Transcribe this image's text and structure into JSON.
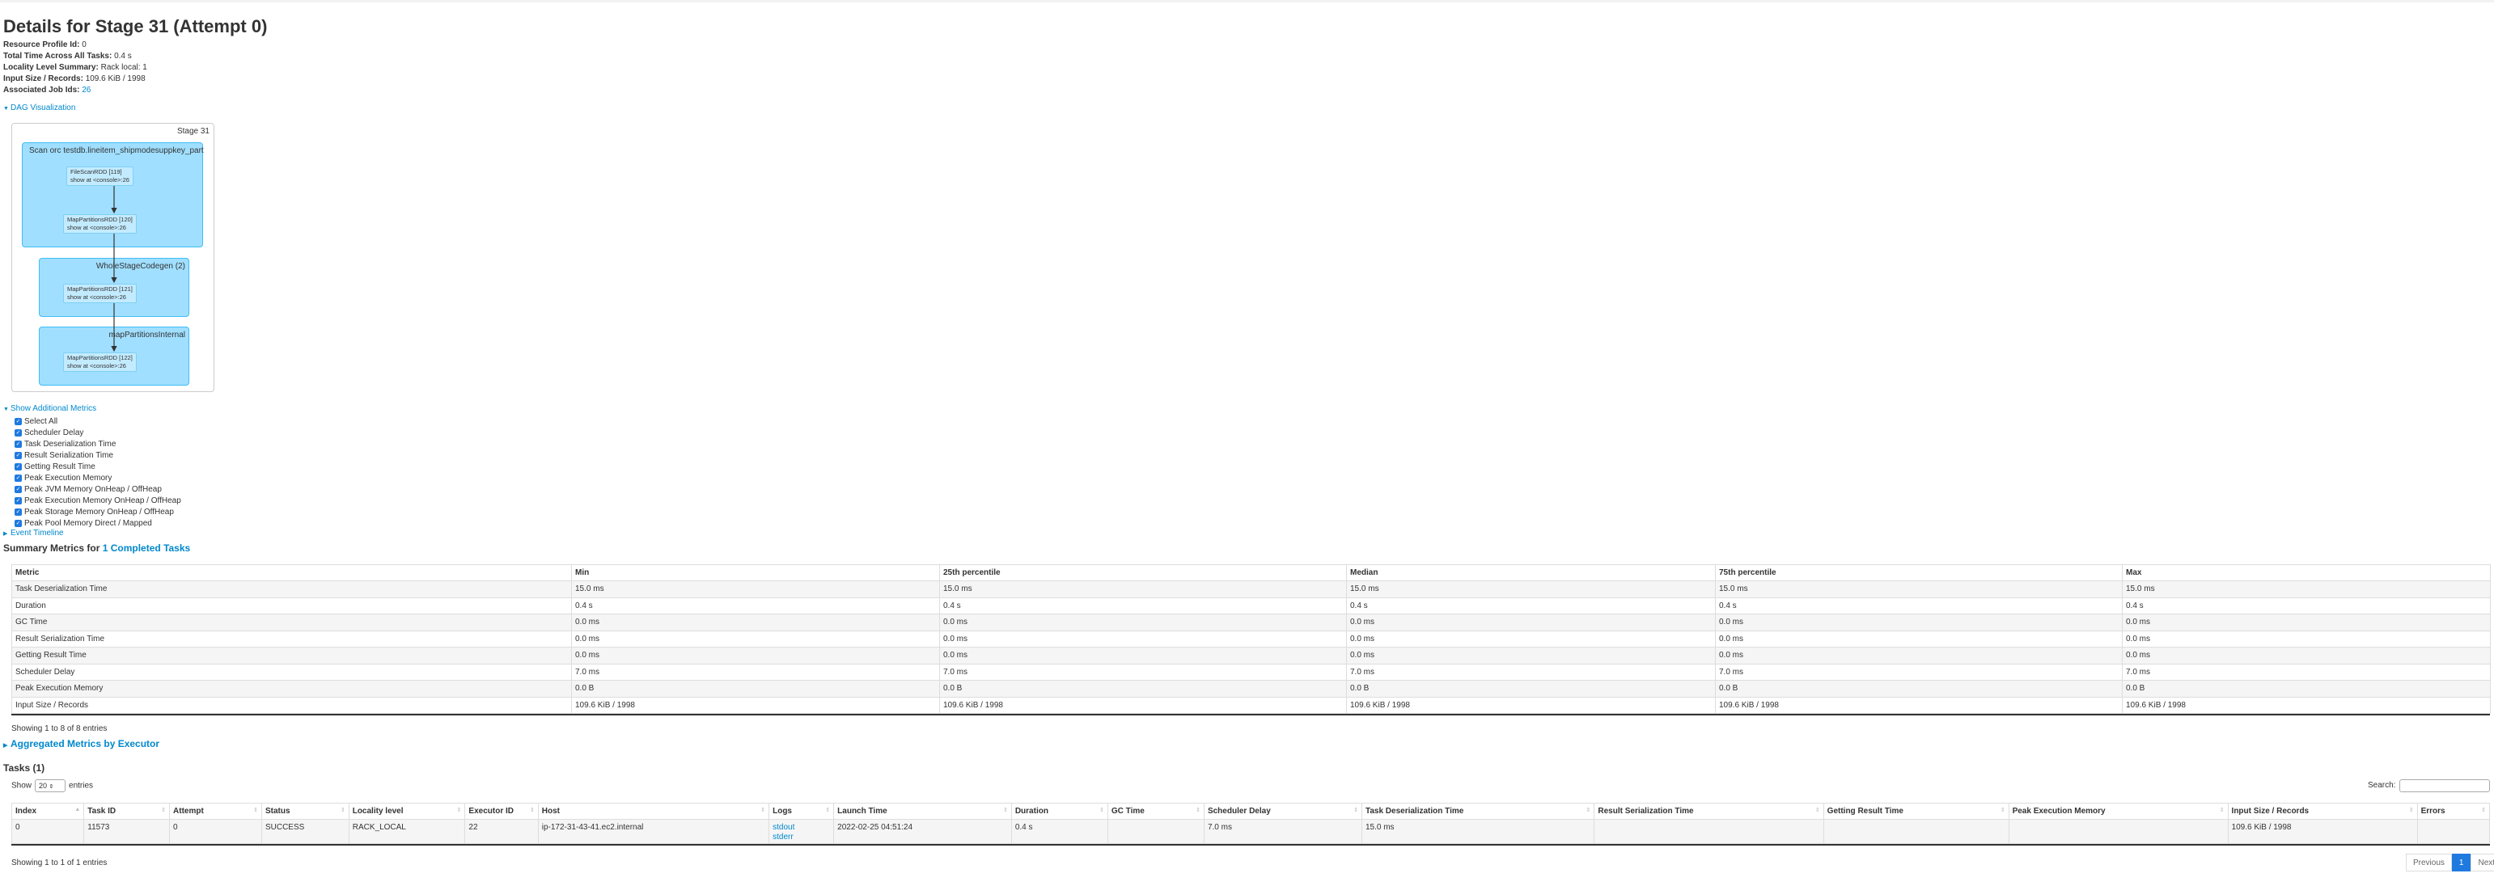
{
  "page": {
    "title": "Details for Stage 31 (Attempt 0)"
  },
  "summary": [
    {
      "label": "Resource Profile Id:",
      "value": "0"
    },
    {
      "label": "Total Time Across All Tasks:",
      "value": "0.4 s"
    },
    {
      "label": "Locality Level Summary:",
      "value": "Rack local: 1"
    },
    {
      "label": "Input Size / Records:",
      "value": "109.6 KiB / 1998"
    },
    {
      "label": "Associated Job Ids:",
      "value": "26"
    }
  ],
  "dag": {
    "toggle_label": "DAG Visualization",
    "stage_label": "Stage 31",
    "clusters": [
      {
        "label": "Scan orc testdb.lineitem_shipmodesuppkey_part"
      },
      {
        "label": "WholeStageCodegen (2)"
      },
      {
        "label": "mapPartitionsInternal"
      }
    ],
    "nodes": [
      {
        "line1": "FileScanRDD [119]",
        "line2": "show at <console>:26"
      },
      {
        "line1": "MapPartitionsRDD [120]",
        "line2": "show at <console>:26"
      },
      {
        "line1": "MapPartitionsRDD [121]",
        "line2": "show at <console>:26"
      },
      {
        "line1": "MapPartitionsRDD [122]",
        "line2": "show at <console>:26"
      }
    ]
  },
  "additional_metrics": {
    "toggle_label": "Show Additional Metrics",
    "items": [
      "Select All",
      "Scheduler Delay",
      "Task Deserialization Time",
      "Result Serialization Time",
      "Getting Result Time",
      "Peak Execution Memory",
      "Peak JVM Memory OnHeap / OffHeap",
      "Peak Execution Memory OnHeap / OffHeap",
      "Peak Storage Memory OnHeap / OffHeap",
      "Peak Pool Memory Direct / Mapped"
    ]
  },
  "event_timeline": {
    "toggle_label": "Event Timeline"
  },
  "summary_metrics": {
    "heading_prefix": "Summary Metrics for",
    "heading_link": "1 Completed Tasks",
    "columns": [
      "Metric",
      "Min",
      "25th percentile",
      "Median",
      "75th percentile",
      "Max"
    ],
    "rows": [
      [
        "Task Deserialization Time",
        "15.0 ms",
        "15.0 ms",
        "15.0 ms",
        "15.0 ms",
        "15.0 ms"
      ],
      [
        "Duration",
        "0.4 s",
        "0.4 s",
        "0.4 s",
        "0.4 s",
        "0.4 s"
      ],
      [
        "GC Time",
        "0.0 ms",
        "0.0 ms",
        "0.0 ms",
        "0.0 ms",
        "0.0 ms"
      ],
      [
        "Result Serialization Time",
        "0.0 ms",
        "0.0 ms",
        "0.0 ms",
        "0.0 ms",
        "0.0 ms"
      ],
      [
        "Getting Result Time",
        "0.0 ms",
        "0.0 ms",
        "0.0 ms",
        "0.0 ms",
        "0.0 ms"
      ],
      [
        "Scheduler Delay",
        "7.0 ms",
        "7.0 ms",
        "7.0 ms",
        "7.0 ms",
        "7.0 ms"
      ],
      [
        "Peak Execution Memory",
        "0.0 B",
        "0.0 B",
        "0.0 B",
        "0.0 B",
        "0.0 B"
      ],
      [
        "Input Size / Records",
        "109.6 KiB / 1998",
        "109.6 KiB / 1998",
        "109.6 KiB / 1998",
        "109.6 KiB / 1998",
        "109.6 KiB / 1998"
      ]
    ],
    "footer": "Showing 1 to 8 of 8 entries"
  },
  "aggregated": {
    "toggle_label": "Aggregated Metrics by Executor"
  },
  "tasks": {
    "heading": "Tasks (1)",
    "show_label": "Show",
    "page_size": "20",
    "entries_label": "entries",
    "search_label": "Search:",
    "columns": [
      "Index",
      "Task ID",
      "Attempt",
      "Status",
      "Locality level",
      "Executor ID",
      "Host",
      "Logs",
      "Launch Time",
      "Duration",
      "GC Time",
      "Scheduler Delay",
      "Task Deserialization Time",
      "Result Serialization Time",
      "Getting Result Time",
      "Peak Execution Memory",
      "Input Size / Records",
      "Errors"
    ],
    "row": {
      "index": "0",
      "task_id": "11573",
      "attempt": "0",
      "status": "SUCCESS",
      "locality": "RACK_LOCAL",
      "executor_id": "22",
      "host": "ip-172-31-43-41.ec2.internal",
      "log_stdout": "stdout",
      "log_stderr": "stderr",
      "launch_time": "2022-02-25 04:51:24",
      "duration": "0.4 s",
      "gc_time": "",
      "scheduler_delay": "7.0 ms",
      "task_deser": "15.0 ms",
      "result_ser": "",
      "getting_result": "",
      "peak_exec_mem": "",
      "input_size": "109.6 KiB / 1998",
      "errors": ""
    },
    "footer": "Showing 1 to 1 of 1 entries",
    "pager": {
      "previous": "Previous",
      "current": "1",
      "next": "Next"
    }
  }
}
